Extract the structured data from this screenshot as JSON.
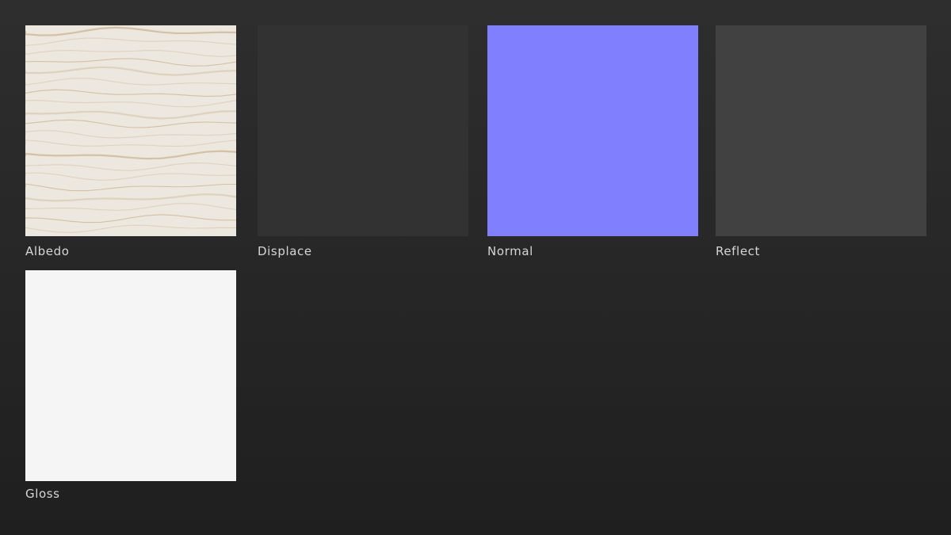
{
  "maps": [
    {
      "label": "Albedo",
      "color": "#ece7df",
      "vein_color": "#cdb48a"
    },
    {
      "label": "Displace",
      "color": "#323232"
    },
    {
      "label": "Normal",
      "color": "#8080ff"
    },
    {
      "label": "Reflect",
      "color": "#414141"
    },
    {
      "label": "Gloss",
      "color": "#f5f5f5"
    }
  ],
  "background": "#2a2a2a",
  "label_color": "#d6d6d6"
}
